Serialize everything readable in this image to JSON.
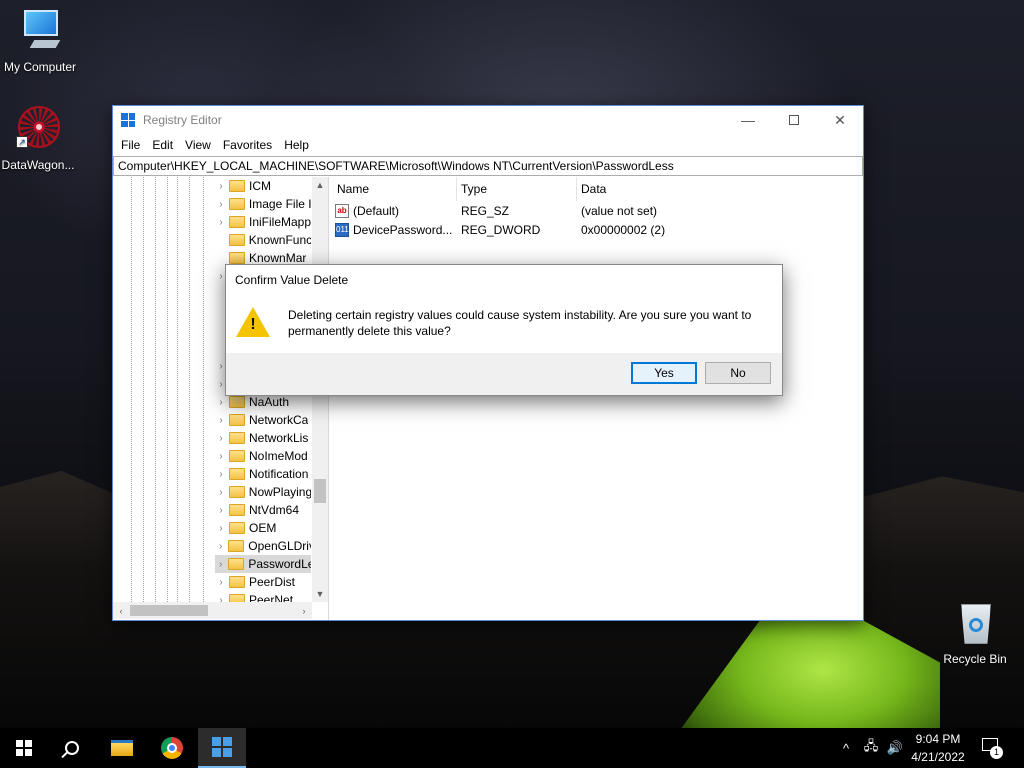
{
  "desktop": {
    "icons": {
      "my_computer": "My Computer",
      "datawagon": "DataWagon...",
      "recycle_bin": "Recycle Bin"
    }
  },
  "window": {
    "title": "Registry Editor",
    "controls": {
      "minimize": "—",
      "close": "✕"
    },
    "menu": [
      "File",
      "Edit",
      "View",
      "Favorites",
      "Help"
    ],
    "address": "Computer\\HKEY_LOCAL_MACHINE\\SOFTWARE\\Microsoft\\Windows NT\\CurrentVersion\\PasswordLess"
  },
  "tree": {
    "items": [
      {
        "label": "ICM",
        "expander": "›"
      },
      {
        "label": "Image File I",
        "expander": "›"
      },
      {
        "label": "IniFileMapp",
        "expander": "›"
      },
      {
        "label": "KnownFunc",
        "expander": ""
      },
      {
        "label": "KnownMar",
        "expander": ""
      },
      {
        "label": "",
        "expander": "›"
      },
      {
        "label": "",
        "expander": ""
      },
      {
        "label": "",
        "expander": ""
      },
      {
        "label": "",
        "expander": ""
      },
      {
        "label": "",
        "expander": ""
      },
      {
        "label": "",
        "expander": "›"
      },
      {
        "label": "",
        "expander": "›"
      },
      {
        "label": "NaAuth",
        "expander": "›"
      },
      {
        "label": "NetworkCa",
        "expander": "›"
      },
      {
        "label": "NetworkLis",
        "expander": "›"
      },
      {
        "label": "NoImeMod",
        "expander": "›"
      },
      {
        "label": "Notification",
        "expander": "›"
      },
      {
        "label": "NowPlaying",
        "expander": "›"
      },
      {
        "label": "NtVdm64",
        "expander": "›"
      },
      {
        "label": "OEM",
        "expander": "›"
      },
      {
        "label": "OpenGLDriv",
        "expander": "›"
      },
      {
        "label": "PasswordLe",
        "expander": "›",
        "selected": true
      },
      {
        "label": "PeerDist",
        "expander": "›"
      },
      {
        "label": "PeerNet",
        "expander": "›"
      }
    ],
    "scroll": {
      "up": "▲",
      "down": "▼",
      "left": "‹",
      "right": "›"
    }
  },
  "list": {
    "columns": {
      "name": "Name",
      "type": "Type",
      "data": "Data"
    },
    "rows": [
      {
        "icon": "ab",
        "name": "(Default)",
        "type": "REG_SZ",
        "data": "(value not set)"
      },
      {
        "icon": "011",
        "name": "DevicePassword...",
        "type": "REG_DWORD",
        "data": "0x00000002 (2)"
      }
    ]
  },
  "dialog": {
    "title": "Confirm Value Delete",
    "icon": "!",
    "message": "Deleting certain registry values could cause system instability. Are you sure you want to permanently delete this value?",
    "yes": "Yes",
    "no": "No"
  },
  "taskbar": {
    "tray": {
      "chevron": "^",
      "network": "🖧",
      "volume": "🔊"
    },
    "time": "9:04 PM",
    "date": "4/21/2022",
    "notification_count": "1"
  },
  "colors": {
    "accent": "#0078d7",
    "selection": "#d9d9d9",
    "warning": "#f5c400"
  }
}
